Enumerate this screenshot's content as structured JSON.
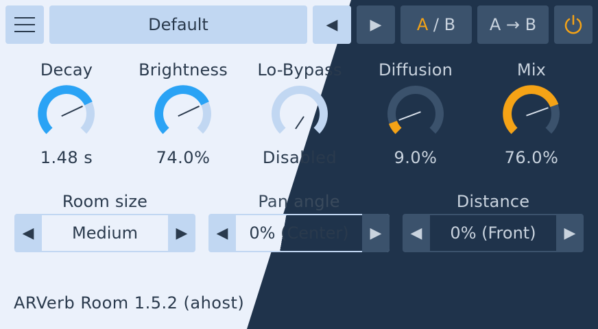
{
  "toolbar": {
    "menu_icon": "hamburger-menu-icon",
    "preset_name": "Default",
    "prev_arrow": "◀",
    "next_arrow": "▶",
    "ab_a": "A",
    "ab_sep": " / ",
    "ab_b": "B",
    "copy_ab": "A → B",
    "power_icon": "power-icon"
  },
  "knobs": [
    {
      "label": "Decay",
      "value": "1.48 s",
      "level": 0.74,
      "enabled": true
    },
    {
      "label": "Brightness",
      "value": "74.0%",
      "level": 0.74,
      "enabled": true
    },
    {
      "label": "Lo-Bypass",
      "value": "Disabled",
      "level": 0.0,
      "enabled": false
    },
    {
      "label": "Diffusion",
      "value": "9.0%",
      "level": 0.09,
      "enabled": true
    },
    {
      "label": "Mix",
      "value": "76.0%",
      "level": 0.76,
      "enabled": true
    }
  ],
  "selectors": [
    {
      "label": "Room size",
      "value": "Medium",
      "left": "◀",
      "right": "▶"
    },
    {
      "label": "Pan angle",
      "value": "0% (Center)",
      "left": "◀",
      "right": "▶"
    },
    {
      "label": "Distance",
      "value": "0% (Front)",
      "left": "◀",
      "right": "▶"
    }
  ],
  "footer": {
    "version": "ARVerb Room 1.5.2 (ahost)"
  },
  "colors": {
    "light_bg": "#ebf1fb",
    "dark_bg": "#1f334b",
    "blue_accent": "#2aa3f5",
    "orange_accent": "#f5a316",
    "light_track": "#c1d7f2",
    "dark_track": "#3b526c"
  }
}
